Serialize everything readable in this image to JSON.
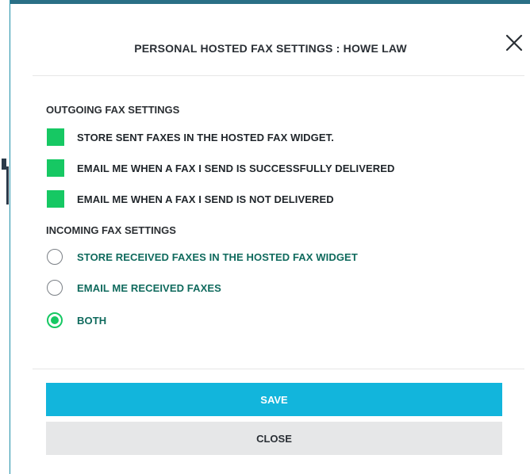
{
  "dialog": {
    "title": "PERSONAL HOSTED FAX SETTINGS : HOWE LAW",
    "close_icon": "close-icon"
  },
  "outgoing": {
    "heading": "OUTGOING FAX SETTINGS",
    "options": [
      {
        "label": "STORE SENT FAXES IN THE HOSTED FAX WIDGET.",
        "checked": true
      },
      {
        "label": "EMAIL ME WHEN A FAX I SEND IS SUCCESSFULLY DELIVERED",
        "checked": true
      },
      {
        "label": "EMAIL ME WHEN A FAX I SEND IS NOT DELIVERED",
        "checked": true
      }
    ]
  },
  "incoming": {
    "heading": "INCOMING FAX SETTINGS",
    "options": [
      {
        "label": "STORE RECEIVED FAXES IN THE HOSTED FAX WIDGET",
        "selected": false
      },
      {
        "label": "EMAIL ME RECEIVED FAXES",
        "selected": false
      },
      {
        "label": "BOTH",
        "selected": true
      }
    ]
  },
  "buttons": {
    "save": "SAVE",
    "close": "CLOSE"
  },
  "colors": {
    "accent_green": "#16c863",
    "save_blue": "#12b5dc",
    "radio_label_teal": "#0f6a5d",
    "close_gray": "#e6e7e8"
  }
}
